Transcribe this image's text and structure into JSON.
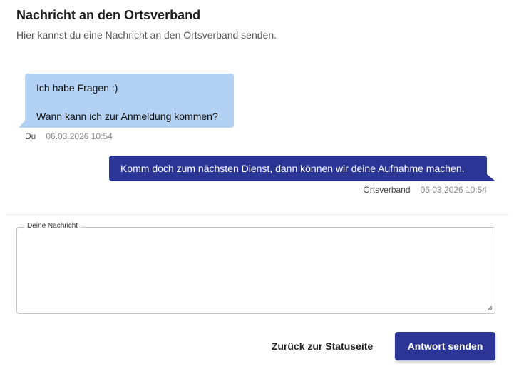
{
  "header": {
    "title": "Nachricht an den Ortsverband",
    "subtitle": "Hier kannst du eine Nachricht an den Ortsverband senden."
  },
  "messages": [
    {
      "direction": "incoming",
      "lines": [
        "Ich habe Fragen :)",
        "Wann kann ich zur Anmeldung kommen?"
      ],
      "sender": "Du",
      "timestamp": "06.03.2026 10:54"
    },
    {
      "direction": "outgoing",
      "lines": [
        "Komm doch zum nächsten Dienst, dann können wir deine Aufnahme machen."
      ],
      "sender": "Ortsverband",
      "timestamp": "06.03.2026 10:54"
    }
  ],
  "form": {
    "label": "Deine Nachricht",
    "value": ""
  },
  "actions": {
    "back_label": "Zurück zur Statuseite",
    "send_label": "Antwort senden"
  },
  "colors": {
    "incoming_bubble": "#b3d1f2",
    "outgoing_bubble": "#2a3596",
    "primary_button": "#2a3596"
  },
  "icons": {
    "resize": "resize-handle-icon"
  }
}
